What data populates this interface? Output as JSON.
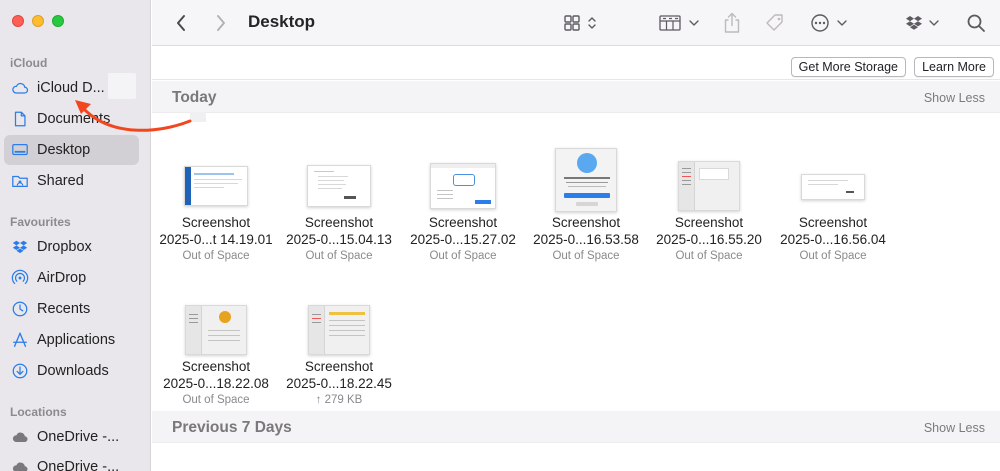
{
  "window": {
    "title": "Desktop"
  },
  "sidebar": {
    "sections": [
      {
        "heading": "iCloud",
        "items": [
          {
            "label": "iCloud D...",
            "icon": "icloud-icon",
            "selected": false
          },
          {
            "label": "Documents",
            "icon": "document-icon",
            "selected": false
          },
          {
            "label": "Desktop",
            "icon": "desktop-icon",
            "selected": true
          },
          {
            "label": "Shared",
            "icon": "shared-folder-icon",
            "selected": false
          }
        ]
      },
      {
        "heading": "Favourites",
        "items": [
          {
            "label": "Dropbox",
            "icon": "dropbox-icon"
          },
          {
            "label": "AirDrop",
            "icon": "airdrop-icon"
          },
          {
            "label": "Recents",
            "icon": "clock-icon"
          },
          {
            "label": "Applications",
            "icon": "applications-icon"
          },
          {
            "label": "Downloads",
            "icon": "download-icon"
          }
        ]
      },
      {
        "heading": "Locations",
        "items": [
          {
            "label": "OneDrive -...",
            "icon": "cloud-icon"
          },
          {
            "label": "OneDrive -...",
            "icon": "cloud-icon"
          }
        ]
      }
    ]
  },
  "storage": {
    "get_more": "Get More Storage",
    "learn_more": "Learn More"
  },
  "groups": [
    {
      "title": "Today",
      "toggle": "Show Less"
    },
    {
      "title": "Previous 7 Days",
      "toggle": "Show Less"
    }
  ],
  "files": [
    {
      "line1": "Screenshot",
      "line2": "2025-0...t 14.19.01",
      "meta": "Out of Space"
    },
    {
      "line1": "Screenshot",
      "line2": "2025-0...15.04.13",
      "meta": "Out of Space"
    },
    {
      "line1": "Screenshot",
      "line2": "2025-0...15.27.02",
      "meta": "Out of Space"
    },
    {
      "line1": "Screenshot",
      "line2": "2025-0...16.53.58",
      "meta": "Out of Space"
    },
    {
      "line1": "Screenshot",
      "line2": "2025-0...16.55.20",
      "meta": "Out of Space"
    },
    {
      "line1": "Screenshot",
      "line2": "2025-0...16.56.04",
      "meta": "Out of Space"
    },
    {
      "line1": "Screenshot",
      "line2": "2025-0...18.22.08",
      "meta": "Out of Space"
    },
    {
      "line1": "Screenshot",
      "line2": "2025-0...18.22.45",
      "meta": "↑ 279 KB"
    }
  ],
  "colors": {
    "accent": "#2b7de9",
    "annotation_arrow": "#f2461f",
    "sidebar_bg": "#e9e7eb"
  }
}
